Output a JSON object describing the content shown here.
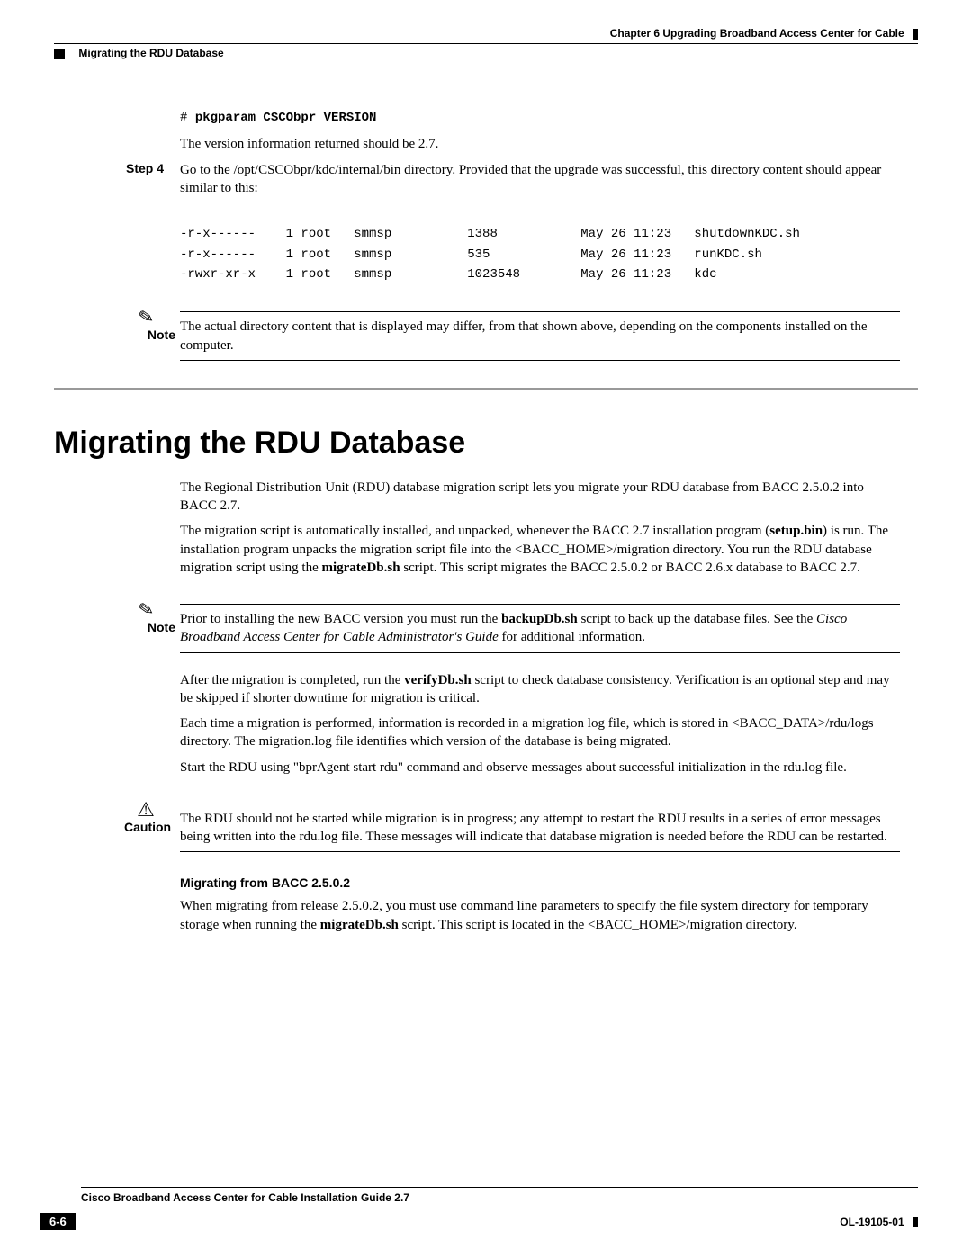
{
  "header": {
    "chapter": "Chapter 6    Upgrading Broadband Access Center for Cable",
    "section": "Migrating the RDU Database"
  },
  "cmd": {
    "prompt": "# ",
    "text": "pkgparam CSCObpr VERSION"
  },
  "version_line": "The version information returned should be 2.7.",
  "step4_label": "Step 4",
  "step4_text": "Go to the /opt/CSCObpr/kdc/internal/bin directory. Provided that the upgrade was successful, this directory content should appear similar to this:",
  "listing": "-r-x------    1 root   smmsp          1388           May 26 11:23   shutdownKDC.sh\n-r-x------    1 root   smmsp          535            May 26 11:23   runKDC.sh\n-rwxr-xr-x    1 root   smmsp          1023548        May 26 11:23   kdc",
  "note1": {
    "label": "Note",
    "text": "The actual directory content that is displayed may differ, from that shown above, depending on the components installed on the computer."
  },
  "h1": "Migrating the RDU Database",
  "para1": "The Regional Distribution Unit (RDU) database migration script lets you migrate your RDU database from BACC 2.5.0.2 into BACC 2.7.",
  "para2_a": "The migration script is automatically installed, and unpacked, whenever the BACC 2.7 installation program (",
  "para2_b": "setup.bin",
  "para2_c": ") is run. The installation program unpacks the migration script file into the <BACC_HOME>/migration directory. You run the RDU database migration script using the ",
  "para2_d": "migrateDb.sh",
  "para2_e": " script. This script migrates the BACC 2.5.0.2 or BACC 2.6.x database to BACC 2.7.",
  "note2": {
    "label": "Note",
    "a": "Prior to installing the new BACC version you must run the ",
    "b": "backupDb.sh",
    "c": " script to back up the database files. See the ",
    "d": "Cisco Broadband Access Center for Cable Administrator's Guide",
    "e": " for additional information."
  },
  "para3_a": "After the migration is completed, run the ",
  "para3_b": "verifyDb.sh",
  "para3_c": " script to check database consistency.  Verification is an optional step and may be skipped if shorter downtime for migration is critical.",
  "para4": "Each time a migration is performed, information is recorded in a migration log file, which is stored in <BACC_DATA>/rdu/logs directory. The migration.log file identifies which version of the database is being migrated.",
  "para5": "Start the RDU using \"bprAgent start rdu\" command and observe messages about successful initialization in the rdu.log file.",
  "caution": {
    "label": "Caution",
    "text": "The RDU should not be started while migration is in progress; any attempt to restart the RDU results in a series of error messages being written into the rdu.log file. These messages will indicate that database migration is needed before the RDU can be restarted."
  },
  "subheading": "Migrating from BACC 2.5.0.2",
  "para6_a": "When migrating from release 2.5.0.2, you must use command line parameters to specify the file system directory for temporary storage when running the ",
  "para6_b": "migrateDb.sh",
  "para6_c": " script. This script is located in the <BACC_HOME>/migration directory.",
  "footer": {
    "title": "Cisco Broadband Access Center for Cable Installation Guide 2.7",
    "page": "6-6",
    "docid": "OL-19105-01"
  }
}
